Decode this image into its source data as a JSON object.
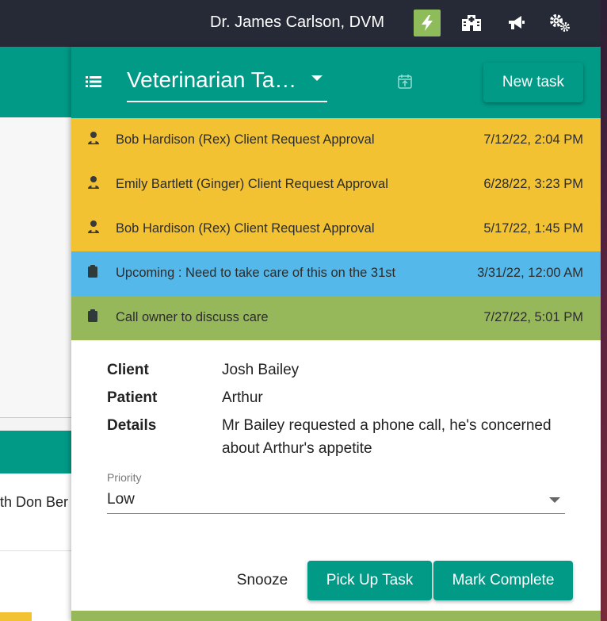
{
  "header": {
    "user_name": "Dr. James Carlson, DVM",
    "icons": [
      "bolt-icon",
      "hospital-icon",
      "megaphone-icon",
      "gears-icon"
    ]
  },
  "background": {
    "partial_row_text": "th Don Ber"
  },
  "panel": {
    "title": "Veterinarian Ta…",
    "new_task_label": "New task",
    "tasks": [
      {
        "label": "Bob Hardison (Rex) Client Request Approval",
        "date": "7/12/22, 2:04 PM",
        "color": "#f2c232",
        "icon": "person-icon"
      },
      {
        "label": "Emily Bartlett (Ginger) Client Request Approval",
        "date": "6/28/22, 3:23 PM",
        "color": "#f2c232",
        "icon": "person-icon"
      },
      {
        "label": "Bob Hardison (Rex) Client Request Approval",
        "date": "5/17/22, 1:45 PM",
        "color": "#f2c232",
        "icon": "person-icon"
      },
      {
        "label": "Upcoming : Need to take care of this on the 31st",
        "date": "3/31/22, 12:00 AM",
        "color": "#55b8ea",
        "icon": "clipboard-icon"
      },
      {
        "label": "Call owner to discuss care",
        "date": "7/27/22, 5:01 PM",
        "color": "#96b85a",
        "icon": "clipboard-icon"
      }
    ],
    "detail": {
      "client_label": "Client",
      "client_value": "Josh Bailey",
      "patient_label": "Patient",
      "patient_value": "Arthur",
      "details_label": "Details",
      "details_value": "Mr Bailey requested a phone call, he's concerned about Arthur's appetite",
      "priority_label": "Priority",
      "priority_value": "Low",
      "snooze_label": "Snooze",
      "pickup_label": "Pick Up Task",
      "complete_label": "Mark Complete"
    }
  },
  "colors": {
    "teal": "#009a86",
    "yellow": "#f2c232",
    "blue": "#55b8ea",
    "green": "#96b85a",
    "topbar": "#262a36"
  }
}
